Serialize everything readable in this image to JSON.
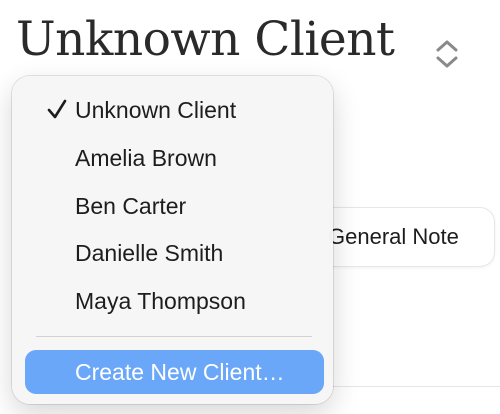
{
  "header": {
    "title": "Unknown Client",
    "stepper_icon": "chevron-up-down-icon"
  },
  "background": {
    "note_button_label": "General Note"
  },
  "menu": {
    "check_icon": "checkmark-icon",
    "items": [
      {
        "label": "Unknown Client",
        "checked": true
      },
      {
        "label": "Amelia Brown",
        "checked": false
      },
      {
        "label": "Ben Carter",
        "checked": false
      },
      {
        "label": "Danielle Smith",
        "checked": false
      },
      {
        "label": "Maya Thompson",
        "checked": false
      }
    ],
    "create_label": "Create New Client…"
  },
  "colors": {
    "highlight": "#6aa7f8",
    "menu_background": "#f6f6f6"
  }
}
